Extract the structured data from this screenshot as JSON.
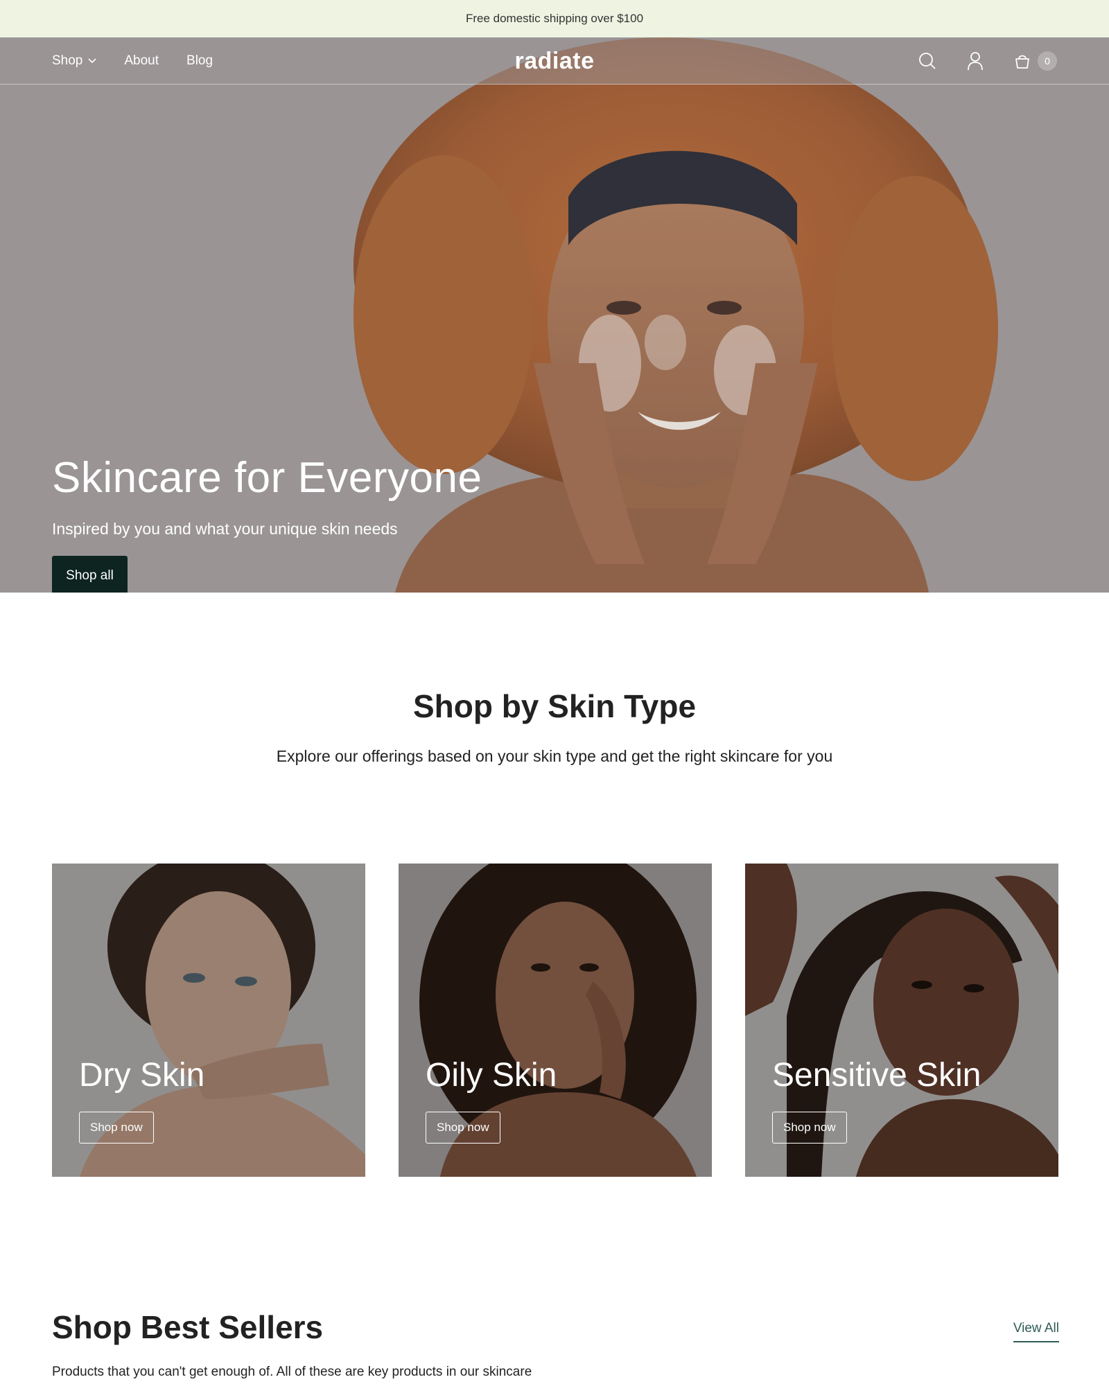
{
  "announcement": {
    "text": "Free domestic shipping over $100"
  },
  "header": {
    "nav": [
      {
        "label": "Shop",
        "has_dropdown": true
      },
      {
        "label": "About"
      },
      {
        "label": "Blog"
      }
    ],
    "logo": "radiate",
    "icons": [
      "search-icon",
      "account-icon",
      "bag-icon"
    ],
    "cart_count": "0"
  },
  "hero": {
    "title": "Skincare for Everyone",
    "subtitle": "Inspired by you and what your unique skin needs",
    "button": "Shop all"
  },
  "skin_type": {
    "title": "Shop by Skin Type",
    "subtitle": "Explore our offerings based on your skin type and get the right skincare for you",
    "cards": [
      {
        "title": "Dry Skin",
        "button": "Shop now"
      },
      {
        "title": "Oily Skin",
        "button": "Shop now"
      },
      {
        "title": "Sensitive Skin",
        "button": "Shop now"
      }
    ]
  },
  "best_sellers": {
    "title": "Shop Best Sellers",
    "view_all": "View All",
    "subtitle": "Products that you can't get enough of. All of these are key products in our skincare"
  },
  "colors": {
    "announcement_bg": "#eef3e2",
    "hero_bg": "#9a9496",
    "button_dark": "#0d2421",
    "link_accent": "#2f5b54"
  }
}
